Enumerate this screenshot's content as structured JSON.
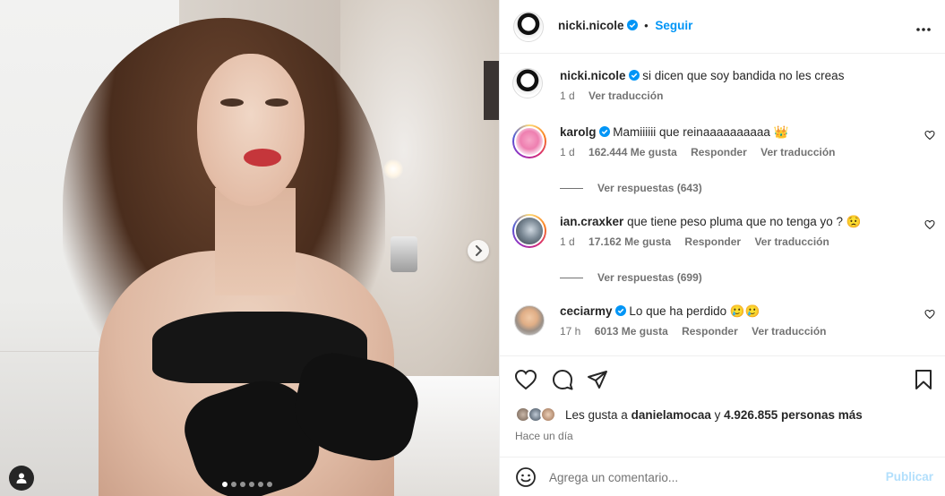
{
  "post": {
    "author": "nicki.nicole",
    "follow_label": "Seguir",
    "more_icon": "more-horizontal-icon",
    "carousel_dots": 6,
    "carousel_active_index": 0
  },
  "caption": {
    "username": "nicki.nicole",
    "text": "si dicen que soy bandida no les creas",
    "time": "1 d",
    "translate": "Ver traducción"
  },
  "comments": [
    {
      "username": "karolg",
      "text": "Mamiiiiii que reinaaaaaaaaaa 👑",
      "time": "1 d",
      "likes": "162.444 Me gusta",
      "reply": "Responder",
      "translate": "Ver traducción",
      "replies": "Ver respuestas (643)"
    },
    {
      "username": "ian.craxker",
      "text": "que tiene peso pluma que no tenga yo ? 😟",
      "time": "1 d",
      "likes": "17.162 Me gusta",
      "reply": "Responder",
      "translate": "Ver traducción",
      "replies": "Ver respuestas (699)"
    },
    {
      "username": "ceciarmy",
      "text": "Lo que ha perdido 🥲🥲",
      "time": "17 h",
      "likes": "6013 Me gusta",
      "reply": "Responder",
      "translate": "Ver traducción"
    }
  ],
  "likes": {
    "prefix": "Les gusta a",
    "user": "danielamocaa",
    "connector": "y",
    "others": "4.926.855 personas más"
  },
  "timestamp": "Hace un día",
  "comment_box": {
    "placeholder": "Agrega un comentario...",
    "publish": "Publicar"
  },
  "colors": {
    "accent": "#0095f6",
    "verified": "#0095f6",
    "muted": "#737373",
    "publish_disabled": "#b2dffc"
  }
}
